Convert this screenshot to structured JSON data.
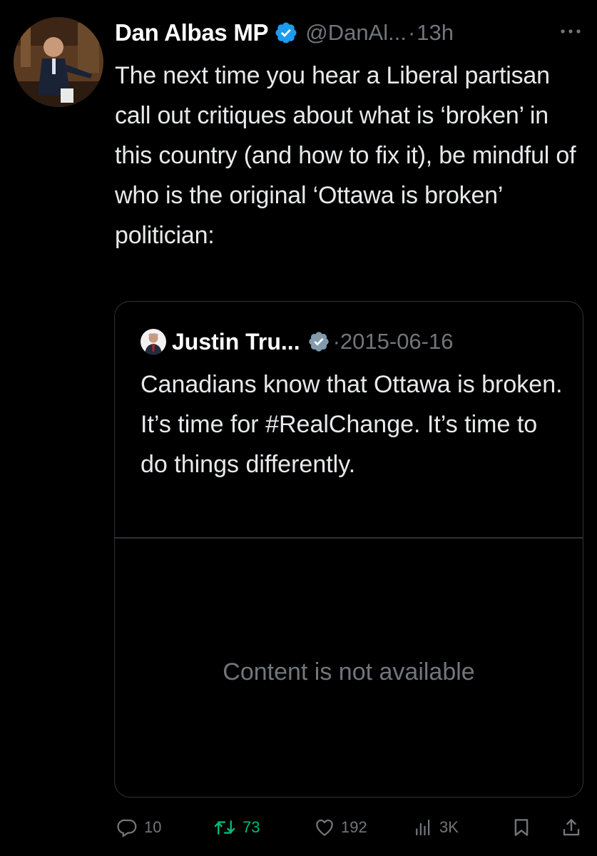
{
  "tweet": {
    "author": {
      "display_name": "Dan Albas MP",
      "handle": "@DanAl...",
      "verified": true,
      "avatar_icon": "avatar-photo"
    },
    "separator": "·",
    "time": "13h",
    "more_icon": "more-icon",
    "text": "The next time you hear a Liberal partisan call out critiques about what is ‘broken’ in this country (and how to fix it), be mindful of who is the original ‘Ottawa is broken’ politician:"
  },
  "quoted_tweet": {
    "author": {
      "display_name": "Justin Tru...",
      "verified": true,
      "avatar_icon": "avatar-photo"
    },
    "separator": "·",
    "date": "2015-06-16",
    "text": "Canadians know that Ottawa is broken. It’s time for #RealChange. It’s time to do things differently.",
    "media_status": "Content is not available"
  },
  "actions": {
    "reply": {
      "icon": "reply-icon",
      "count": "10"
    },
    "retweet": {
      "icon": "retweet-icon",
      "count": "73"
    },
    "like": {
      "icon": "heart-icon",
      "count": "192"
    },
    "views": {
      "icon": "views-icon",
      "count": "3K"
    },
    "bookmark": {
      "icon": "bookmark-icon"
    },
    "share": {
      "icon": "share-icon"
    }
  },
  "colors": {
    "background": "#000000",
    "text": "#e7e9ea",
    "secondary_text": "#71767b",
    "verified_blue": "#1d9bf0",
    "quote_verified_gray": "#829aab",
    "retweet_green": "#00ba7c",
    "border": "#2f3336"
  }
}
